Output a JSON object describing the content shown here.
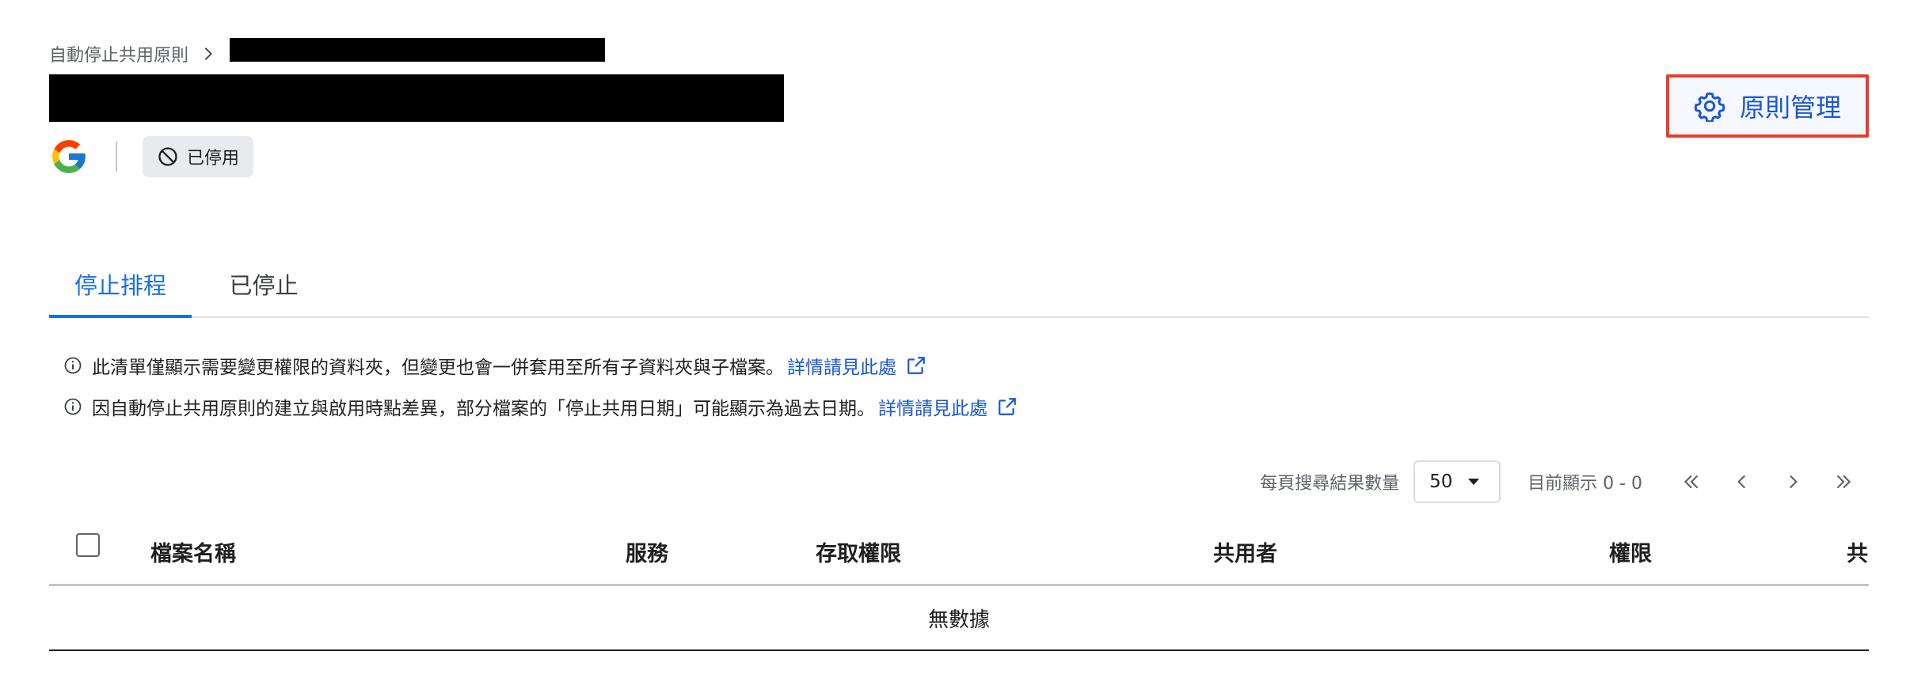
{
  "breadcrumb": {
    "parent": "自動停止共用原則"
  },
  "status": {
    "label": "已停用"
  },
  "actions": {
    "manage_label": "原則管理"
  },
  "tabs": [
    {
      "label": "停止排程",
      "active": true
    },
    {
      "label": "已停止",
      "active": false
    }
  ],
  "notices": [
    {
      "text": "此清單僅顯示需要變更權限的資料夾，但變更也會一併套用至所有子資料夾與子檔案。",
      "link": "詳情請見此處"
    },
    {
      "text": "因自動停止共用原則的建立與啟用時點差異，部分檔案的「停止共用日期」可能顯示為過去日期。",
      "link": "詳情請見此處"
    }
  ],
  "pagination": {
    "per_page_label": "每頁搜尋結果數量",
    "per_page_value": "50",
    "showing": "目前顯示 0 - 0"
  },
  "table": {
    "columns": [
      "檔案名稱",
      "服務",
      "存取權限",
      "共用者",
      "權限",
      "共"
    ],
    "empty_text": "無數據"
  },
  "colors": {
    "accent": "#1a6fe0",
    "link": "#1a56d6",
    "highlight_border": "#e53e2b",
    "badge_bg": "#e8eaed"
  },
  "icons": {
    "service": "google-icon",
    "status": "disabled-icon",
    "manage": "gear-icon",
    "notice": "info-icon",
    "link": "external-link-icon"
  }
}
